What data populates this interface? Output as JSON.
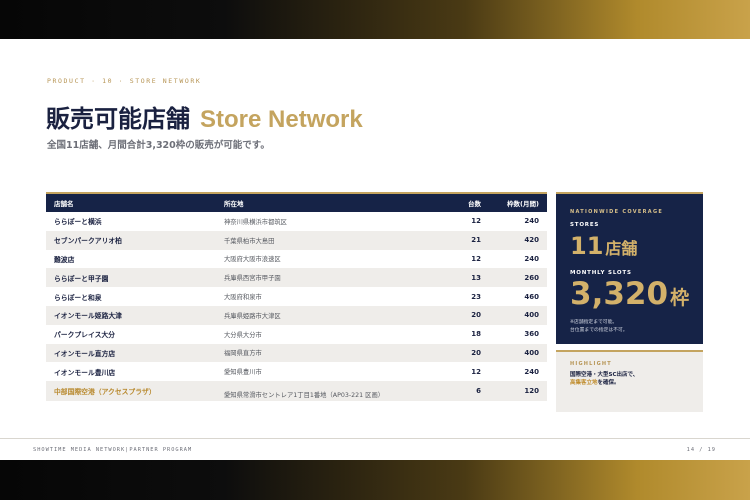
{
  "header": {
    "eyebrow": "PRODUCT · 10 · STORE NETWORK",
    "title_jp": "販売可能店舗",
    "title_en": "Store Network",
    "subtitle": "全国11店舗、月間合計3,320枠の販売が可能です。"
  },
  "table": {
    "columns": [
      "店舗名",
      "所在地",
      "台数",
      "枠数(月間)"
    ],
    "rows": [
      {
        "name": "ららぽーと横浜",
        "location": "神奈川県横浜市都筑区",
        "units": "12",
        "slots": "240"
      },
      {
        "name": "セブンパークアリオ柏",
        "location": "千葉県柏市大島田",
        "units": "21",
        "slots": "420"
      },
      {
        "name": "難波店",
        "location": "大阪府大阪市浪速区",
        "units": "12",
        "slots": "240"
      },
      {
        "name": "ららぽーと甲子園",
        "location": "兵庫県西宮市甲子園",
        "units": "13",
        "slots": "260"
      },
      {
        "name": "ららぽーと和泉",
        "location": "大阪府和泉市",
        "units": "23",
        "slots": "460"
      },
      {
        "name": "イオンモール姫路大津",
        "location": "兵庫県姫路市大津区",
        "units": "20",
        "slots": "400"
      },
      {
        "name": "パークプレイス大分",
        "location": "大分県大分市",
        "units": "18",
        "slots": "360"
      },
      {
        "name": "イオンモール直方店",
        "location": "福岡県直方市",
        "units": "20",
        "slots": "400"
      },
      {
        "name": "イオンモール豊川店",
        "location": "愛知県豊川市",
        "units": "12",
        "slots": "240"
      },
      {
        "name": "中部国際空港（アクセスプラザ）",
        "location": "愛知県常滑市セントレア1丁目1番地（AP03-221 区画）",
        "units": "6",
        "slots": "120"
      }
    ]
  },
  "panel": {
    "eyebrow": "NATIONWIDE COVERAGE",
    "stores_label": "STORES",
    "stores_value": "11",
    "stores_unit": "店舗",
    "slots_label": "MONTHLY SLOTS",
    "slots_value": "3,320",
    "slots_unit": "枠",
    "note_line1": "※店舗指定まで可能。",
    "note_line2": "台位置までの指定は不可。"
  },
  "highlight": {
    "eyebrow": "HIGHLIGHT",
    "line1": "国際空港・大型SC出店で、",
    "line2_accent": "高集客立地",
    "line2_rest": "を確保。"
  },
  "footer": {
    "left": "SHOWTIME MEDIA NETWORK|PARTNER PROGRAM",
    "right": "14 / 19"
  },
  "colors": {
    "navy": "#162347",
    "gold": "#c4a45f",
    "gold_bright": "#d3b16a",
    "row_alt": "#efedea"
  }
}
